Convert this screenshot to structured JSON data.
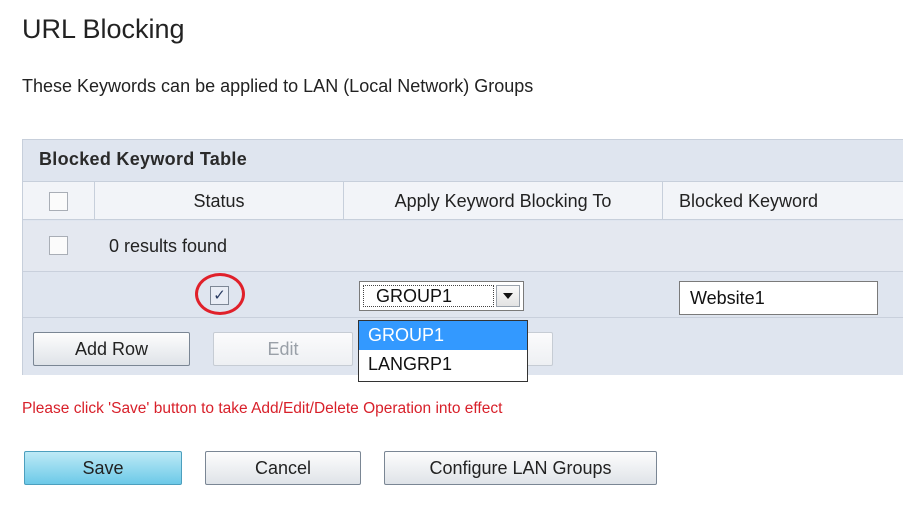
{
  "page": {
    "title": "URL Blocking",
    "subtitle": "These Keywords can be applied to LAN (Local Network) Groups"
  },
  "table": {
    "title": "Blocked Keyword Table",
    "columns": [
      "Status",
      "Apply Keyword Blocking To",
      "Blocked Keyword"
    ],
    "results_text": "0 results found",
    "edit_row": {
      "status_checked": true,
      "group_value": "GROUP1",
      "keyword_value": "Website1"
    }
  },
  "dropdown": {
    "options": [
      "GROUP1",
      "LANGRP1"
    ],
    "selected_index": 0
  },
  "row_buttons": {
    "add_row": "Add Row",
    "edit": "Edit"
  },
  "notice": "Please click 'Save' button to take Add/Edit/Delete Operation into effect",
  "footer_buttons": {
    "save": "Save",
    "cancel": "Cancel",
    "configure": "Configure LAN Groups"
  },
  "colors": {
    "highlight_ring": "#e0202a",
    "notice_text": "#d8202a",
    "selected_option": "#3399ff",
    "save_button": "#6cc9e8"
  },
  "icons": {
    "checkbox_check": "checkmark-icon",
    "select_arrow": "chevron-down-icon"
  }
}
